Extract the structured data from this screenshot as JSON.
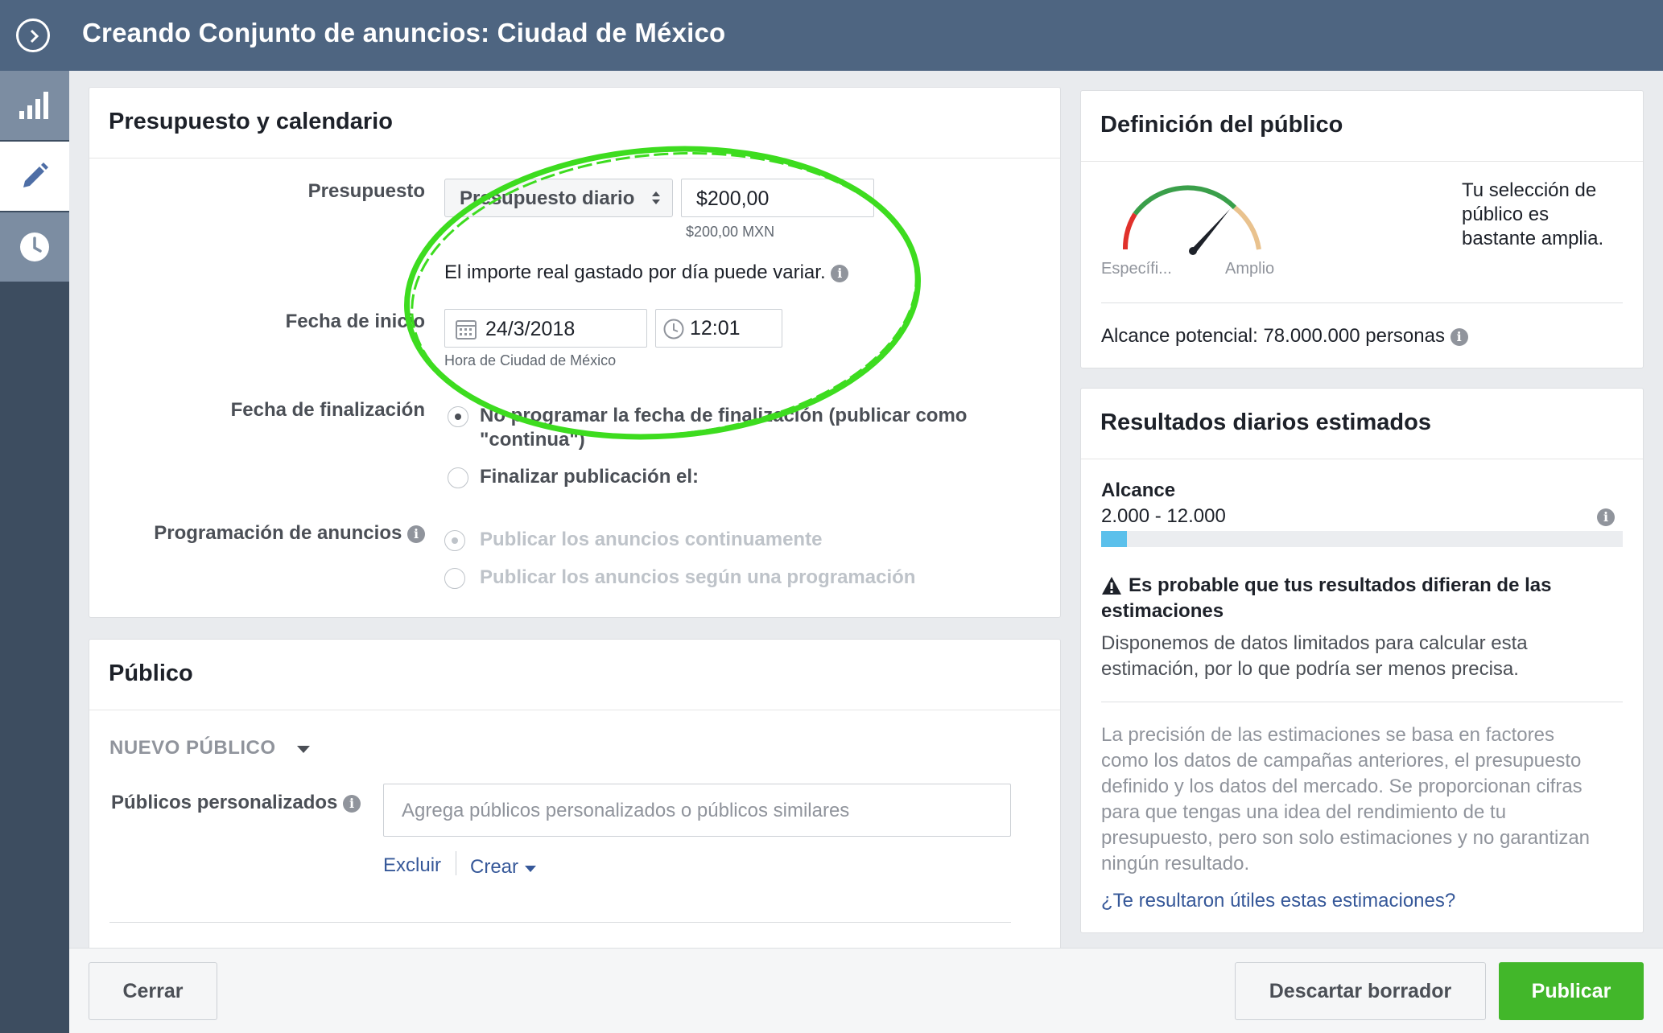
{
  "header": {
    "title": "Creando Conjunto de anuncios: Ciudad de México"
  },
  "budget_section": {
    "title": "Presupuesto y calendario",
    "budget_label": "Presupuesto",
    "budget_type": "Presupuesto diario",
    "budget_amount": "$200,00",
    "budget_currency_note": "$200,00 MXN",
    "budget_hint": "El importe real gastado por día puede variar.",
    "start_label": "Fecha de inicio",
    "start_date": "24/3/2018",
    "start_time": "12:01",
    "timezone_note": "Hora de Ciudad de México",
    "end_label": "Fecha de finalización",
    "end_option_1_line1": "No programar la fecha de finalización (publicar como",
    "end_option_1_line2": "\"continua\")",
    "end_option_2": "Finalizar publicación el:",
    "schedule_label": "Programación de anuncios",
    "schedule_option_1": "Publicar los anuncios continuamente",
    "schedule_option_2": "Publicar los anuncios según una programación"
  },
  "audience_section": {
    "title": "Público",
    "new_audience": "NUEVO PÚBLICO",
    "custom_label": "Públicos personalizados",
    "custom_placeholder": "Agrega públicos personalizados o públicos similares",
    "exclude_link": "Excluir",
    "create_link": "Crear"
  },
  "audience_definition": {
    "title": "Definición del público",
    "gauge_left": "Específi...",
    "gauge_right": "Amplio",
    "summary_line1": "Tu selección de",
    "summary_line2": "público es",
    "summary_line3": "bastante amplia.",
    "potential_reach": "Alcance potencial: 78.000.000 personas"
  },
  "daily_results": {
    "title": "Resultados diarios estimados",
    "reach_label": "Alcance",
    "reach_value": "2.000 - 12.000",
    "reach_bar_fill_fraction": 0.05,
    "warning_line1": "Es probable que tus resultados difieran de las",
    "warning_line2": "estimaciones",
    "limited_line1": "Disponemos de datos limitados para calcular esta",
    "limited_line2": "estimación, por lo que podría ser menos precisa.",
    "accuracy_lines": [
      "La precisión de las estimaciones se basa en factores",
      "como los datos de campañas anteriores, el presupuesto",
      "definido y los datos del mercado. Se proporcionan cifras",
      "para que tengas una idea del rendimiento de tu",
      "presupuesto, pero son solo estimaciones y no garantizan",
      "ningún resultado."
    ],
    "feedback_link": "¿Te resultaron útiles estas estimaciones?"
  },
  "footer": {
    "close": "Cerrar",
    "discard": "Descartar borrador",
    "publish": "Publicar"
  },
  "colors": {
    "header_bg": "#4e6581",
    "rail_bg": "#3d4d60",
    "link": "#365899",
    "publish_green": "#42b72a",
    "reach_bar": "#5bc0eb",
    "annotation_green": "#3ddc1f"
  },
  "icons": [
    "chevron-right-circle-icon",
    "bar-chart-icon",
    "pencil-icon",
    "clock-icon",
    "calendar-icon",
    "info-icon",
    "warning-icon",
    "caret-down-icon",
    "sort-caret-icon"
  ]
}
